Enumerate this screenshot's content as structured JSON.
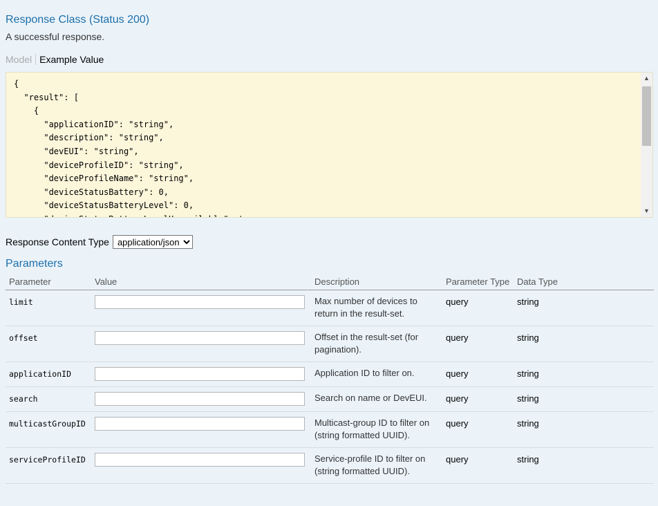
{
  "response": {
    "title": "Response Class (Status 200)",
    "subtitle": "A successful response.",
    "tabs": {
      "model": "Model",
      "example": "Example Value"
    },
    "code_lines": [
      "{",
      "  \"result\": [",
      "    {",
      "      \"applicationID\": \"string\",",
      "      \"description\": \"string\",",
      "      \"devEUI\": \"string\",",
      "      \"deviceProfileID\": \"string\",",
      "      \"deviceProfileName\": \"string\",",
      "      \"deviceStatusBattery\": 0,",
      "      \"deviceStatusBatteryLevel\": 0,",
      "      \"deviceStatusBatteryLevelUnavailable\": true,"
    ]
  },
  "content_type": {
    "label": "Response Content Type",
    "selected": "application/json"
  },
  "parameters": {
    "title": "Parameters",
    "headers": [
      "Parameter",
      "Value",
      "Description",
      "Parameter Type",
      "Data Type"
    ],
    "rows": [
      {
        "name": "limit",
        "description": "Max number of devices to return in the result-set.",
        "param_type": "query",
        "data_type": "string"
      },
      {
        "name": "offset",
        "description": "Offset in the result-set (for pagination).",
        "param_type": "query",
        "data_type": "string"
      },
      {
        "name": "applicationID",
        "description": "Application ID to filter on.",
        "param_type": "query",
        "data_type": "string"
      },
      {
        "name": "search",
        "description": "Search on name or DevEUI.",
        "param_type": "query",
        "data_type": "string"
      },
      {
        "name": "multicastGroupID",
        "description": "Multicast-group ID to filter on (string formatted UUID).",
        "param_type": "query",
        "data_type": "string"
      },
      {
        "name": "serviceProfileID",
        "description": "Service-profile ID to filter on (string formatted UUID).",
        "param_type": "query",
        "data_type": "string"
      }
    ]
  },
  "colors": {
    "background": "#ebf3f9",
    "heading": "#1e6fa9",
    "code_background": "#fcf6db"
  }
}
